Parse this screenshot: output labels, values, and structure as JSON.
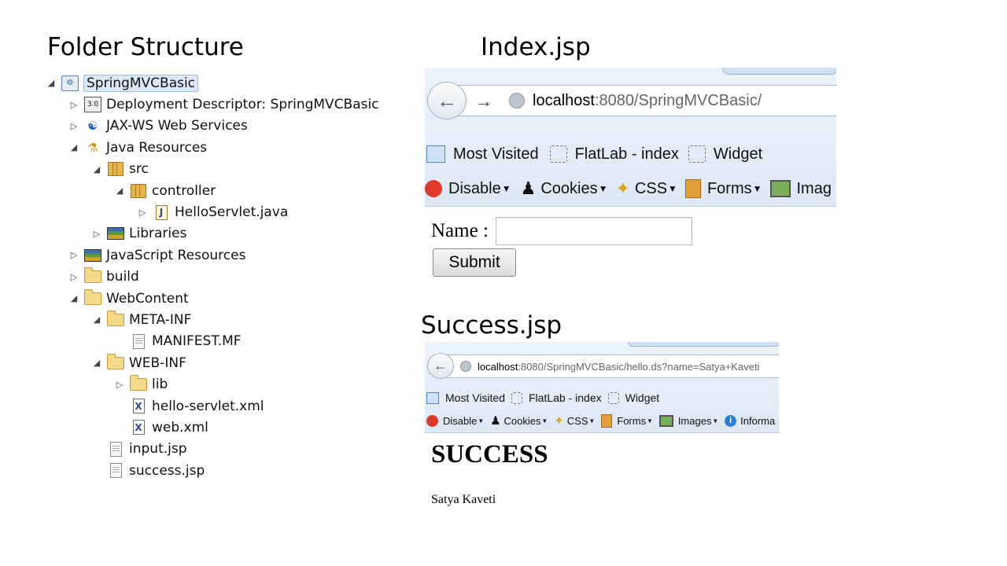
{
  "headings": {
    "folder_structure": "Folder Structure",
    "index_jsp": "Index.jsp",
    "success_jsp": "Success.jsp"
  },
  "tree": [
    {
      "label": "SpringMVCBasic",
      "depth": 0,
      "toggle": "expanded",
      "icon": "project-icon",
      "selected": true
    },
    {
      "label": "Deployment Descriptor: SpringMVCBasic",
      "depth": 1,
      "toggle": "collapsed",
      "icon": "deployment-descriptor-icon"
    },
    {
      "label": "JAX-WS Web Services",
      "depth": 1,
      "toggle": "collapsed",
      "icon": "web-services-icon"
    },
    {
      "label": "Java Resources",
      "depth": 1,
      "toggle": "expanded",
      "icon": "java-resources-icon"
    },
    {
      "label": "src",
      "depth": 2,
      "toggle": "expanded",
      "icon": "source-folder-icon"
    },
    {
      "label": "controller",
      "depth": 3,
      "toggle": "expanded",
      "icon": "package-icon"
    },
    {
      "label": "HelloServlet.java",
      "depth": 4,
      "toggle": "collapsed",
      "icon": "java-file-icon"
    },
    {
      "label": "Libraries",
      "depth": 2,
      "toggle": "collapsed",
      "icon": "libraries-icon"
    },
    {
      "label": "JavaScript Resources",
      "depth": 1,
      "toggle": "collapsed",
      "icon": "libraries-icon"
    },
    {
      "label": "build",
      "depth": 1,
      "toggle": "collapsed",
      "icon": "folder-icon"
    },
    {
      "label": "WebContent",
      "depth": 1,
      "toggle": "expanded",
      "icon": "folder-icon"
    },
    {
      "label": "META-INF",
      "depth": 2,
      "toggle": "expanded",
      "icon": "folder-icon"
    },
    {
      "label": "MANIFEST.MF",
      "depth": 3,
      "toggle": "none",
      "icon": "file-icon"
    },
    {
      "label": "WEB-INF",
      "depth": 2,
      "toggle": "expanded",
      "icon": "folder-icon"
    },
    {
      "label": "lib",
      "depth": 3,
      "toggle": "collapsed",
      "icon": "folder-icon"
    },
    {
      "label": "hello-servlet.xml",
      "depth": 3,
      "toggle": "none",
      "icon": "xml-file-icon"
    },
    {
      "label": "web.xml",
      "depth": 3,
      "toggle": "none",
      "icon": "xml-file-icon"
    },
    {
      "label": "input.jsp",
      "depth": 2,
      "toggle": "none",
      "icon": "file-icon"
    },
    {
      "label": "success.jsp",
      "depth": 2,
      "toggle": "none",
      "icon": "file-icon"
    }
  ],
  "index_browser": {
    "url_host": "localhost",
    "url_path": ":8080/SpringMVCBasic/",
    "bookmarks": [
      "Most Visited",
      "FlatLab - index",
      "Widget"
    ],
    "toolbar": [
      "Disable",
      "Cookies",
      "CSS",
      "Forms",
      "Imag"
    ],
    "form": {
      "name_label": "Name :",
      "input_value": "",
      "submit_label": "Submit"
    }
  },
  "success_browser": {
    "url_host": "localhost",
    "url_path": ":8080/SpringMVCBasic/hello.ds?name=Satya+Kaveti",
    "bookmarks": [
      "Most Visited",
      "FlatLab - index",
      "Widget"
    ],
    "toolbar": [
      "Disable",
      "Cookies",
      "CSS",
      "Forms",
      "Images",
      "Informa"
    ],
    "title": "SUCCESS",
    "message": "Satya Kaveti"
  }
}
